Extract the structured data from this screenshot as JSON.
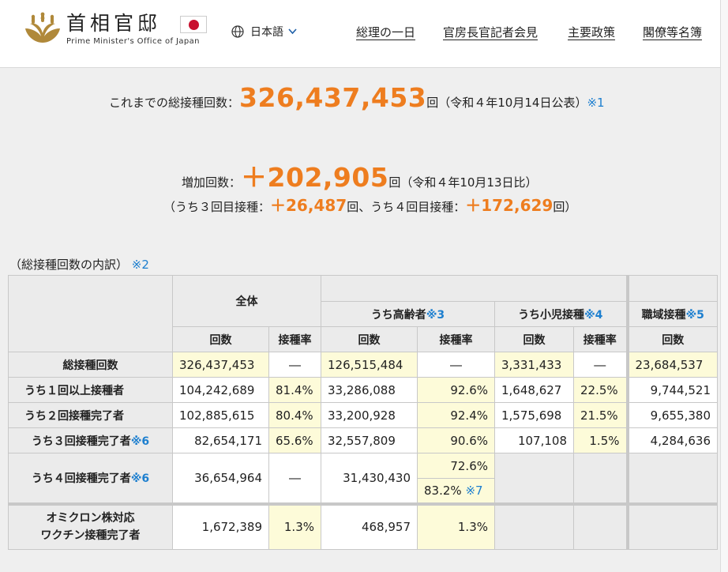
{
  "header": {
    "logo_jp": "首相官邸",
    "logo_en": "Prime Minister's Office of Japan",
    "language": "日本語",
    "nav": [
      "総理の一日",
      "官房長官記者会見",
      "主要政策",
      "閣僚等名簿"
    ]
  },
  "summary": {
    "total_prefix": "これまでの総接種回数：",
    "total_value": "326,437,453",
    "total_unit": "回",
    "total_note": "（令和４年10月14日公表）",
    "total_ref": "※1",
    "inc_prefix": "増加回数：",
    "inc_value": "＋202,905",
    "inc_unit": "回",
    "inc_note": "（令和４年10月13日比）",
    "sub_open": "（うち３回目接種：",
    "sub_third": "＋26,487",
    "sub_mid": "回、うち４回目接種：",
    "sub_fourth": "＋172,629",
    "sub_close": "回）"
  },
  "breakdown": {
    "label": "（総接種回数の内訳）",
    "ref": "※2"
  },
  "table": {
    "header": {
      "all": "全体",
      "elderly": "うち高齢者",
      "elderly_ref": "※3",
      "child": "うち小児接種",
      "child_ref": "※4",
      "work": "職域接種",
      "work_ref": "※5",
      "count": "回数",
      "rate": "接種率"
    },
    "rows": {
      "total": {
        "label": "総接種回数",
        "all": "326,437,453",
        "all_rate": "―",
        "elderly": "126,515,484",
        "elderly_rate": "―",
        "child": "3,331,433",
        "child_rate": "―",
        "work": "23,684,537"
      },
      "first": {
        "label": "うち１回以上接種者",
        "all": "104,242,689",
        "all_rate": "81.4%",
        "elderly": "33,286,088",
        "elderly_rate": "92.6%",
        "child": "1,648,627",
        "child_rate": "22.5%",
        "work": "9,744,521"
      },
      "second": {
        "label": "うち２回接種完了者",
        "all": "102,885,615",
        "all_rate": "80.4%",
        "elderly": "33,200,928",
        "elderly_rate": "92.4%",
        "child": "1,575,698",
        "child_rate": "21.5%",
        "work": "9,655,380"
      },
      "third": {
        "label": "うち３回接種完了者",
        "ref": "※6",
        "all": "82,654,171",
        "all_rate": "65.6%",
        "elderly": "32,557,809",
        "elderly_rate": "90.6%",
        "child": "107,108",
        "child_rate": "1.5%",
        "work": "4,284,636"
      },
      "fourth": {
        "label": "うち４回接種完了者",
        "ref": "※6",
        "all": "36,654,964",
        "all_rate": "―",
        "elderly": "31,430,430",
        "elderly_rate": "72.6%",
        "elderly_rate2": "83.2%",
        "elderly_rate2_ref": "※7"
      },
      "omicron": {
        "label_line1": "オミクロン株対応",
        "label_line2": "ワクチン接種完了者",
        "all": "1,672,389",
        "all_rate": "1.3%",
        "elderly": "468,957",
        "elderly_rate": "1.3%"
      }
    }
  },
  "colors": {
    "accent": "#ee7d1f",
    "link": "#1d7fcf",
    "highlight": "#fdfbd9"
  }
}
